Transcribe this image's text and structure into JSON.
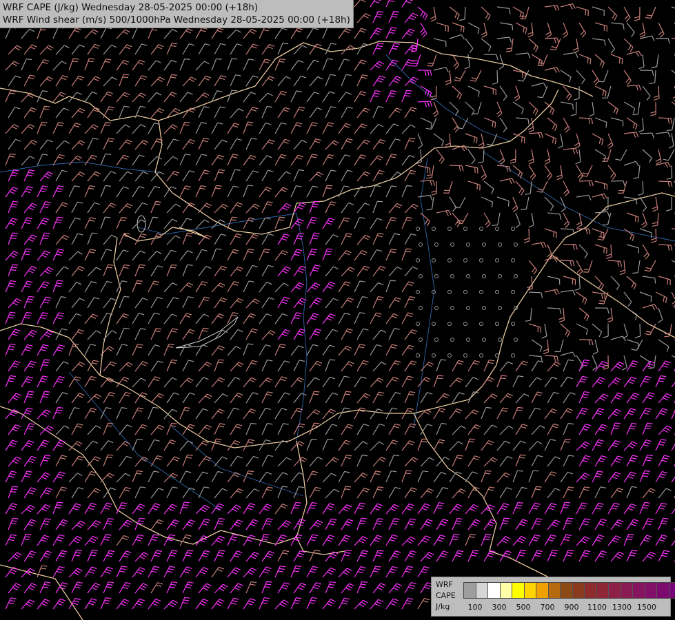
{
  "header": {
    "line1": "WRF CAPE (J/kg) Wednesday 28-05-2025 00:00 (+18h)",
    "line2": "WRF Wind shear (m/s) 500/1000hPa Wednesday 28-05-2025 00:00 (+18h)"
  },
  "legend": {
    "label_line1": "WRF",
    "label_line2": "CAPE",
    "label_line3": "J/kg",
    "colors": [
      "#9e9e9e",
      "#d6d6d6",
      "#ffffff",
      "#ffffa8",
      "#ffff00",
      "#ffd400",
      "#f0a000",
      "#b86a10",
      "#8c4a14",
      "#8a3a1e",
      "#8c2c2c",
      "#8e2638",
      "#8c2046",
      "#8a1a52",
      "#86145e",
      "#820f68",
      "#7e0a70",
      "#780678"
    ],
    "tick_labels": [
      "100",
      "300",
      "500",
      "700",
      "900",
      "1100",
      "1300",
      "1500"
    ]
  },
  "map_style": {
    "background": "#000000",
    "border_color": "#e8c9a0",
    "river_color": "#3a78c8",
    "barb_colors": {
      "weak": "#9a9a9a",
      "moderate": "#c9807a",
      "strong": "#ff33ff"
    }
  }
}
